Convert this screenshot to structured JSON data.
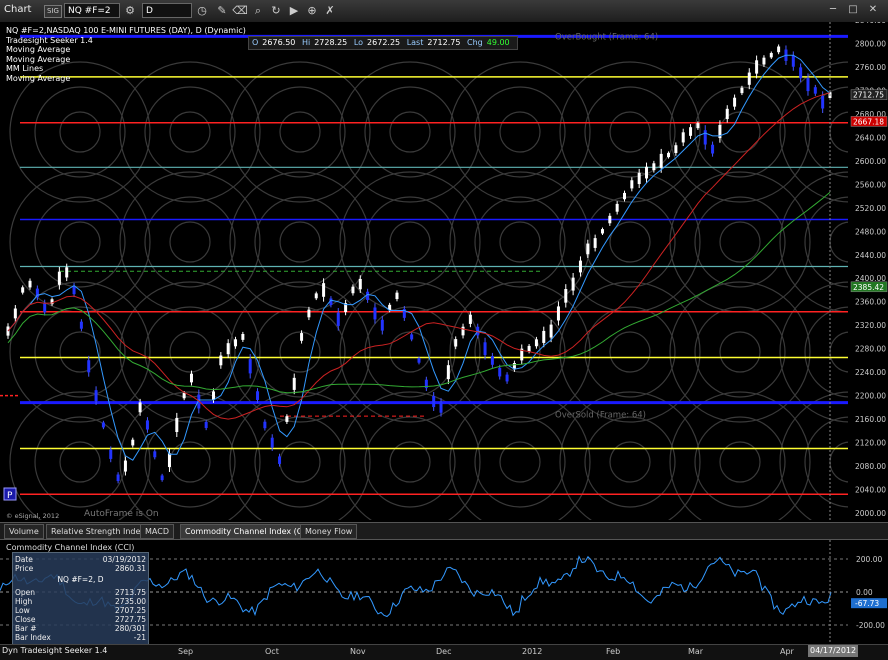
{
  "toolbar": {
    "title": "Chart",
    "badge": "SIG",
    "symbol": "NQ #F=2",
    "interval": "D"
  },
  "legend": {
    "lines": [
      "NQ #F=2,NASDAQ 100 E-MINI FUTURES (DAY), D (Dynamic)",
      "Tradesight Seeker 1.4",
      "Moving Average",
      "Moving Average",
      "MM Lines",
      "Moving Average"
    ]
  },
  "ohlc": {
    "o_label": "O",
    "o": "2676.50",
    "h_label": "Hi",
    "h": "2728.25",
    "l_label": "Lo",
    "l": "2672.25",
    "c_label": "Last",
    "c": "2712.75",
    "chg_label": "Chg",
    "chg": "49.00"
  },
  "annotations": {
    "overbought": "OverBought (Frame: 64)",
    "oversold": "OverSold (Frame: 64)",
    "autoframe": "AutoFrame is On",
    "copyright": "© eSignal, 2012",
    "p_button": "P"
  },
  "price_axis": {
    "ticks": [
      "2840.00",
      "2800.00",
      "2760.00",
      "2720.00",
      "2680.00",
      "2640.00",
      "2600.00",
      "2560.00",
      "2520.00",
      "2480.00",
      "2440.00",
      "2400.00",
      "2360.00",
      "2320.00",
      "2280.00",
      "2240.00",
      "2200.00",
      "2160.00",
      "2120.00",
      "2080.00",
      "2040.00",
      "2000.00"
    ],
    "tags": [
      {
        "value": "2712.75",
        "color": "#ffffff",
        "bg": "#222222"
      },
      {
        "value": "2667.18",
        "color": "#ffffff",
        "bg": "#cc0000"
      },
      {
        "value": "2385.42",
        "color": "#ffffff",
        "bg": "#227722"
      }
    ]
  },
  "tabs": [
    "Volume",
    "Relative Strength Index",
    "MACD",
    "Commodity Channel Index (CCI)",
    "Money Flow"
  ],
  "active_tab": 3,
  "cci": {
    "label": "Commodity Channel Index (CCI)",
    "ticks": [
      "200.00",
      "0.00",
      "-200.00"
    ],
    "tag": "-67.73"
  },
  "databox": {
    "title": "NQ #F=2, D",
    "rows": [
      {
        "k": "Date",
        "v": "03/19/2012"
      },
      {
        "k": "Price",
        "v": "2860.31"
      },
      {
        "k": "Open",
        "v": "2713.75"
      },
      {
        "k": "High",
        "v": "2735.00"
      },
      {
        "k": "Low",
        "v": "2707.25"
      },
      {
        "k": "Close",
        "v": "2727.75"
      },
      {
        "k": "Bar #",
        "v": "280/301"
      },
      {
        "k": "Bar Index",
        "v": "-21"
      }
    ]
  },
  "x_axis": [
    "Sep",
    "Oct",
    "Nov",
    "Dec",
    "2012",
    "Feb",
    "Mar",
    "Apr"
  ],
  "status": "Tradesight Seeker 1.4",
  "status_prefix": "Dyn",
  "date_flag": "04/17/2012",
  "colors": {
    "blue_line": "#1a1aff",
    "yellow_line": "#ffff33",
    "red_line": "#ff2222",
    "teal_line": "#5fb3b3",
    "ma_fast": "#3399ff",
    "ma_mid": "#cc2222",
    "ma_slow": "#33aa33",
    "cci_line": "#3399ff"
  }
}
